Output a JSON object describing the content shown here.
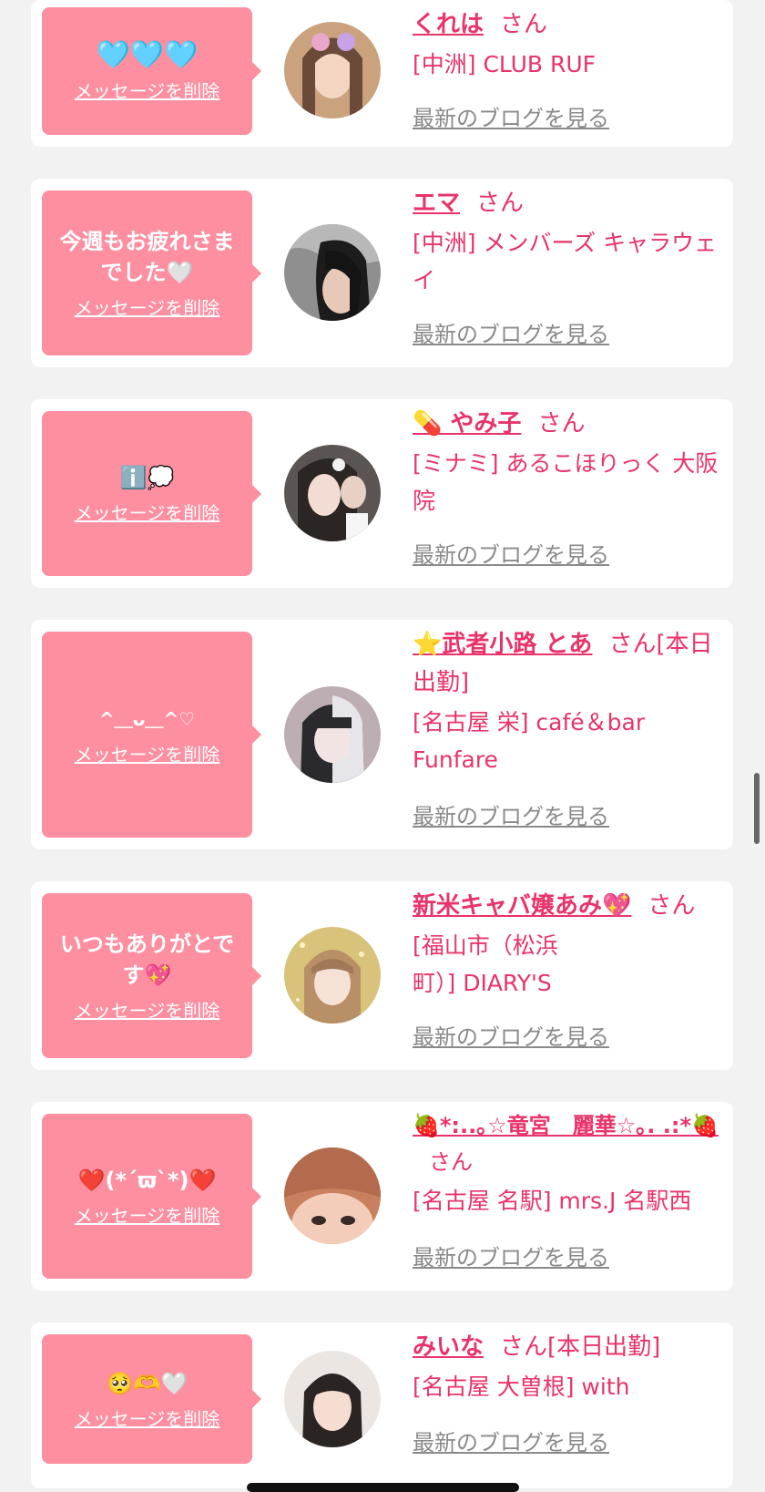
{
  "delete_label": "メッセージを削除",
  "blog_label": "最新のブログを見る",
  "san_label": "さん",
  "colors": {
    "bubble": "#fd8fa1",
    "accent": "#e9336a",
    "link_gray": "#8a8a8a",
    "background": "#f2f2f2"
  },
  "entries": [
    {
      "message": "🩵🩵🩵",
      "name": "くれは",
      "status": "",
      "shop": "[中洲] CLUB RUF"
    },
    {
      "message": "今週もお疲れさまでした🤍",
      "name": "エマ",
      "status": "",
      "shop": "[中洲] メンバーズ キャラウェイ"
    },
    {
      "message": "ℹ️💭",
      "name": "💊 やみ子",
      "status": "",
      "shop": "[ミナミ] あるこほりっく 大阪院"
    },
    {
      "message": "^＿ᴗ＿^♡",
      "name": "⭐武者小路 とあ",
      "status": "[本日出勤]",
      "shop": "[名古屋 栄] café＆bar Funfare"
    },
    {
      "message": "いつもありがとです💖",
      "name": "新米キャバ嬢あみ💖",
      "status": "",
      "shop": "[福山市（松浜町）] DIARY'S"
    },
    {
      "message": "❤️(*´ϖ`*)❤️",
      "name": "🍓*:..｡☆竜宮　麗華☆｡. .:*🍓",
      "status": "",
      "shop": "[名古屋 名駅] mrs.J 名駅西"
    },
    {
      "message": "🥺🫶🤍",
      "name": "みいな",
      "status": "[本日出勤]",
      "shop": "[名古屋 大曽根] with"
    }
  ]
}
